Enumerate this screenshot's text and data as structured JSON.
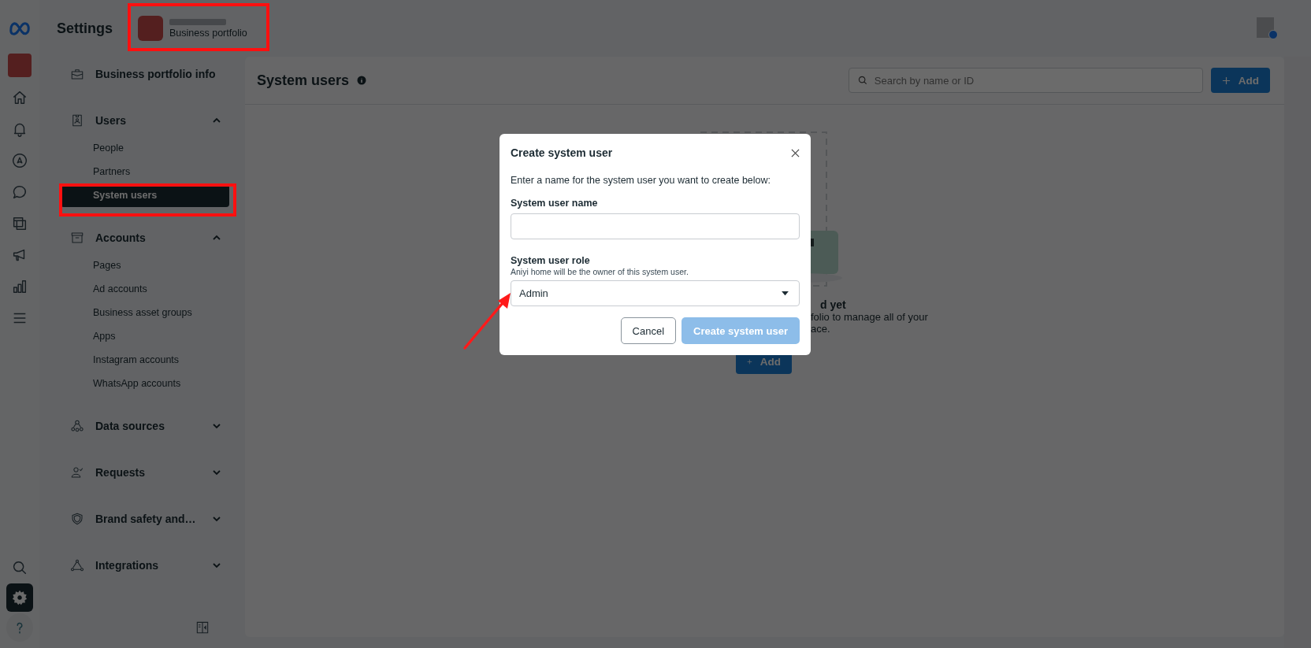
{
  "rail": {
    "top": [
      {
        "selected": false
      },
      {
        "selected": false
      },
      {
        "selected": false
      },
      {
        "selected": false
      },
      {
        "selected": false
      },
      {
        "selected": false
      },
      {
        "selected": false
      },
      {
        "selected": false
      }
    ],
    "bottom": [
      {
        "selected": false
      },
      {
        "selected": true
      },
      {
        "selected": false
      }
    ]
  },
  "header": {
    "title": "Settings",
    "portfolio": {
      "subtitle": "Business portfolio"
    }
  },
  "sidebar": {
    "sections": [
      {
        "label": "Business portfolio info",
        "kind": "link"
      },
      {
        "label": "Users",
        "kind": "group",
        "expanded": true,
        "items": [
          {
            "label": "People",
            "selected": false
          },
          {
            "label": "Partners",
            "selected": false
          },
          {
            "label": "System users",
            "selected": true
          }
        ]
      },
      {
        "label": "Accounts",
        "kind": "group",
        "expanded": true,
        "items": [
          {
            "label": "Pages",
            "selected": false
          },
          {
            "label": "Ad accounts",
            "selected": false
          },
          {
            "label": "Business asset groups",
            "selected": false
          },
          {
            "label": "Apps",
            "selected": false
          },
          {
            "label": "Instagram accounts",
            "selected": false
          },
          {
            "label": "WhatsApp accounts",
            "selected": false
          }
        ]
      },
      {
        "label": "Data sources",
        "kind": "group",
        "expanded": false
      },
      {
        "label": "Requests",
        "kind": "group",
        "expanded": false
      },
      {
        "label": "Brand safety and…",
        "kind": "group",
        "expanded": false
      },
      {
        "label": "Integrations",
        "kind": "group",
        "expanded": false
      }
    ]
  },
  "main": {
    "title": "System users",
    "search": {
      "placeholder": "Search by name or ID"
    },
    "add_button": "Add",
    "empty_state": {
      "title": "d yet",
      "body": [
        "folio to manage all of your",
        "ace."
      ],
      "add_button": "Add"
    }
  },
  "modal": {
    "title": "Create system user",
    "description": "Enter a name for the system user you want to create below:",
    "name_field": {
      "label": "System user name"
    },
    "role_field": {
      "label": "System user role",
      "hint": "Aniyi home will be the owner of this system user.",
      "value": "Admin"
    },
    "buttons": [
      {
        "label": "Cancel",
        "kind": "secondary",
        "disabled": false
      },
      {
        "label": "Create system user",
        "kind": "primary",
        "disabled": true
      }
    ]
  }
}
